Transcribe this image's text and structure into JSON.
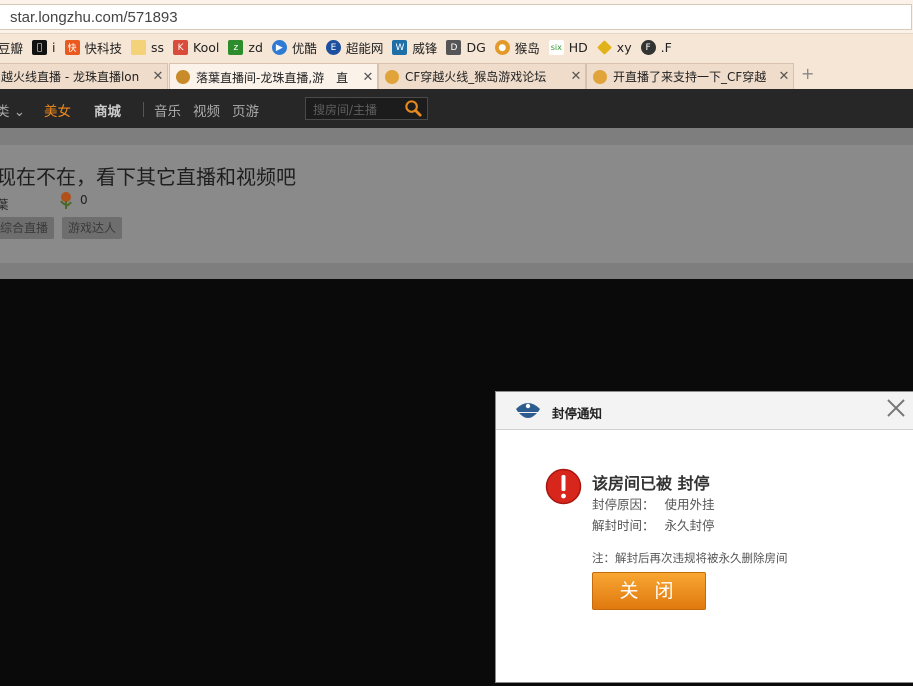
{
  "browser": {
    "url": "star.longzhu.com/571893",
    "bookmarks": [
      {
        "label": "豆瓣",
        "icon": "douban-icon",
        "color": "#3e9a3e"
      },
      {
        "label": "i",
        "icon": "apple-icon",
        "color": "#111111"
      },
      {
        "label": "快科技",
        "icon": "kkj-icon",
        "color": "#ea5a1f"
      },
      {
        "label": "ss",
        "icon": "folder-icon",
        "color": "#f3d27a"
      },
      {
        "label": "Kool",
        "icon": "kool-icon",
        "color": "#d94b3a"
      },
      {
        "label": "zd",
        "icon": "zd-icon",
        "color": "#2d8d2d"
      },
      {
        "label": "优酷",
        "icon": "youku-icon",
        "color": "#2e7bd6"
      },
      {
        "label": "超能网",
        "icon": "expreview-icon",
        "color": "#1c4fa0"
      },
      {
        "label": "威锋",
        "icon": "weiphone-icon",
        "color": "#1e6fa8"
      },
      {
        "label": "DG",
        "icon": "dg-icon",
        "color": "#555555"
      },
      {
        "label": "猴岛",
        "icon": "houdao-icon",
        "color": "#e49a2a"
      },
      {
        "label": "HD",
        "icon": "hd-icon",
        "color": "#2e9b2e"
      },
      {
        "label": "xy",
        "icon": "xy-icon",
        "color": "#e2b21a"
      },
      {
        "label": ".F",
        "icon": "f-icon",
        "color": "#333333"
      }
    ],
    "tabs": [
      {
        "title": "越火线直播 - 龙珠直播lon",
        "active": false,
        "icon": ""
      },
      {
        "title": "落葉直播间-龙珠直播,游　直",
        "active": true,
        "icon": "monkey-icon"
      },
      {
        "title": "CF穿越火线_猴岛游戏论坛",
        "active": false,
        "icon": "monkey-icon"
      },
      {
        "title": "开直播了来支持一下_CF穿越",
        "active": false,
        "icon": "monkey-icon"
      }
    ],
    "newtab_label": "+"
  },
  "site": {
    "nav": {
      "category_label": "类",
      "beauty": "美女",
      "mall": "商城",
      "music": "音乐",
      "video": "视频",
      "webgame": "页游"
    },
    "search_placeholder": "搜房间/主播"
  },
  "room": {
    "offline_title": "现在不在，看下其它直播和视频吧",
    "owner": "葉",
    "flower_count": "0",
    "tags": [
      "综合直播",
      "游戏达人"
    ]
  },
  "modal": {
    "title": "封停通知",
    "heading": "该房间已被 封停",
    "reason_label": "封停原因：",
    "reason_value": "使用外挂",
    "unban_label": "解封时间：",
    "unban_value": "永久封停",
    "note": "注：解封后再次违规将被永久删除房间",
    "close_button": "关 闭"
  },
  "colors": {
    "accent": "#f08a1e",
    "warning": "#d7261c"
  }
}
